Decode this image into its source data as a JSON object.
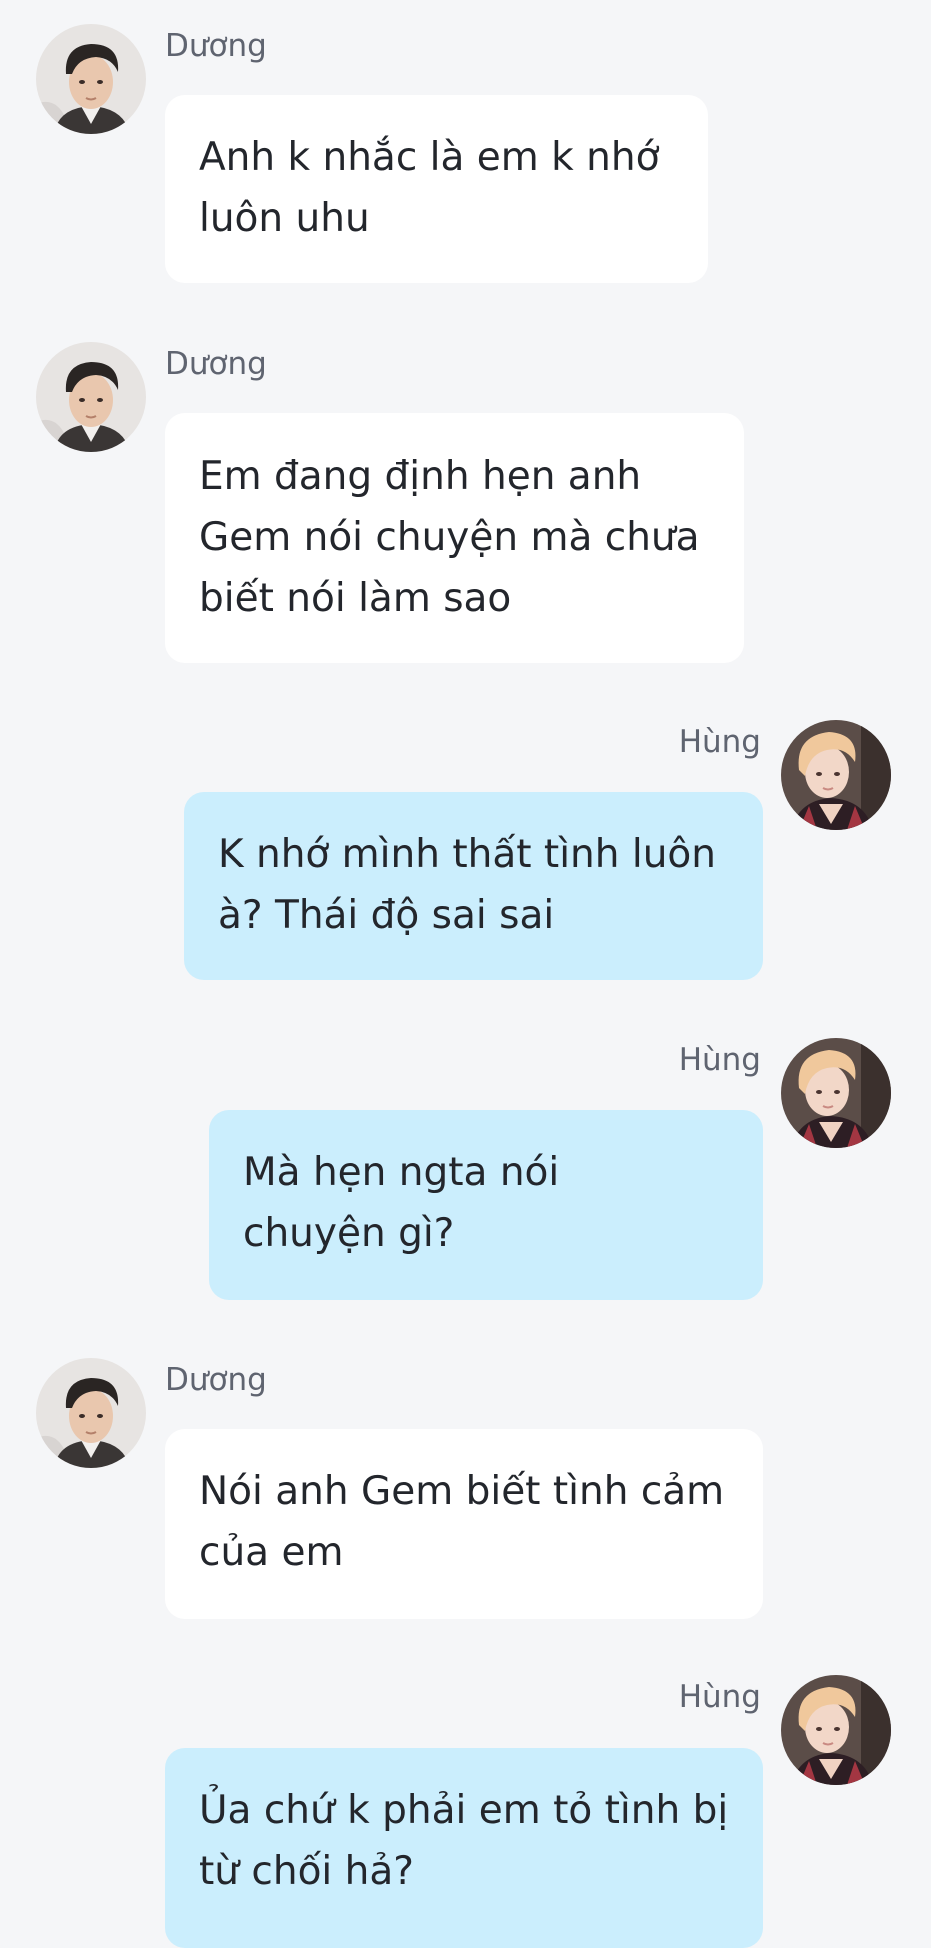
{
  "colors": {
    "background": "#f5f6f8",
    "incoming_bubble": "#ffffff",
    "outgoing_bubble": "#cbeefd",
    "sender_name": "#5f6470",
    "message_text": "#23262c"
  },
  "messages": [
    {
      "sender": "Dương",
      "side": "left",
      "avatar_icon": "duong-avatar-icon",
      "lines": [
        "Anh k nhắc là em k nhớ",
        "luôn uhu"
      ]
    },
    {
      "sender": "Dương",
      "side": "left",
      "avatar_icon": "duong-avatar-icon",
      "lines": [
        "Em đang định hẹn anh",
        "Gem nói chuyện mà chưa",
        "biết nói làm sao"
      ]
    },
    {
      "sender": "Hùng",
      "side": "right",
      "avatar_icon": "hung-avatar-icon",
      "lines": [
        "K nhớ mình thất tình luôn",
        "à? Thái độ sai sai"
      ]
    },
    {
      "sender": "Hùng",
      "side": "right",
      "avatar_icon": "hung-avatar-icon",
      "lines": [
        "Mà hẹn ngta nói",
        "chuyện gì?"
      ]
    },
    {
      "sender": "Dương",
      "side": "left",
      "avatar_icon": "duong-avatar-icon",
      "lines": [
        "Nói anh Gem biết tình cảm",
        "của em"
      ]
    },
    {
      "sender": "Hùng",
      "side": "right",
      "avatar_icon": "hung-avatar-icon",
      "lines": [
        "Ủa chứ k phải em tỏ tình bị",
        "từ chối hả?"
      ]
    }
  ]
}
